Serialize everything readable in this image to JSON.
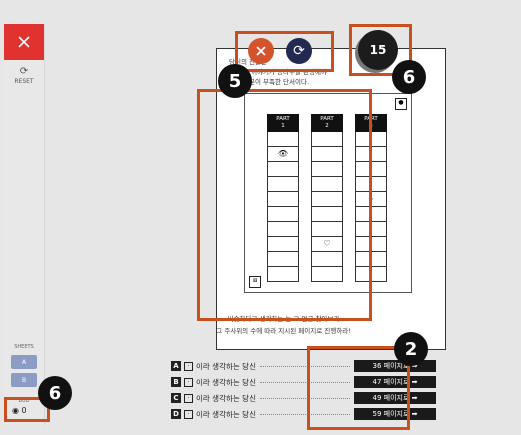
{
  "sidebar": {
    "reset_label": "RESET",
    "sheets_label": "SHEETS",
    "sheet_buttons": [
      "A",
      "B"
    ],
    "money_label": "BUD",
    "coin_count": "0"
  },
  "book": {
    "intro_lines": [
      "당신의 진술은 ",
      "되었다. 이야기가 몽타주를 완성해야 ",
      "어떤 부분이 부족한 단서이다."
    ],
    "parts": [
      "PART\n1",
      "PART\n2",
      "PART\n3"
    ],
    "part_marks": [
      {
        "row": 2,
        "text": "👁"
      },
      {
        "row": 8,
        "text": "♡"
      },
      {
        "row": 5,
        "text": "⌣"
      }
    ],
    "caption": "그 주사위의 수에 따라 지시된 페이지로 진행하라!",
    "caption_top": "비슷하다고 생각하는 는 그 얼굴 찾아보라",
    "choices": [
      {
        "letter": "A",
        "text": "이라 생각하는 당신",
        "goto": "36 페이지로 ➡"
      },
      {
        "letter": "B",
        "text": "이라 생각하는 당신",
        "goto": "47 페이지로 ➡"
      },
      {
        "letter": "C",
        "text": "이라 생각하는 당신",
        "goto": "49 페이지로 ➡"
      },
      {
        "letter": "D",
        "text": "이라 생각하는 당신",
        "goto": "59 페이지로 ➡"
      }
    ]
  },
  "controls": {
    "counter": "15"
  },
  "markers": {
    "m5": "5",
    "m6a": "6",
    "m6b": "6",
    "m2": "2"
  }
}
